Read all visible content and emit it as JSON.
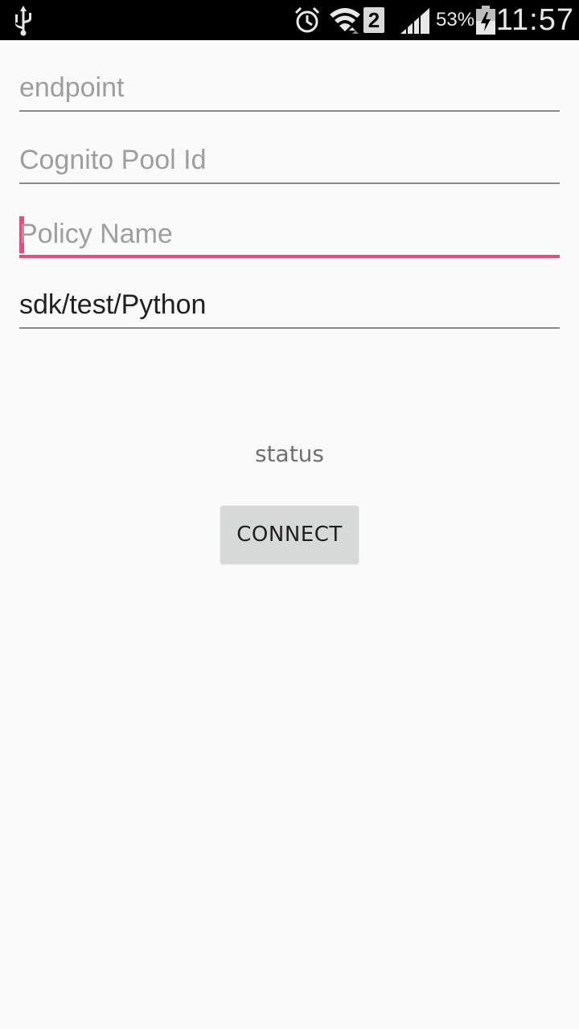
{
  "status_bar": {
    "usb_icon": "usb-icon",
    "alarm_icon": "alarm-icon",
    "wifi_icon": "wifi-icon",
    "sim_badge": "2",
    "signal_icon": "signal-icon",
    "battery_percent": "53%",
    "battery_icon": "battery-charging-icon",
    "time": "11:57"
  },
  "form": {
    "endpoint": {
      "placeholder": "endpoint",
      "value": ""
    },
    "cognito_pool_id": {
      "placeholder": "Cognito Pool Id",
      "value": ""
    },
    "policy_name": {
      "placeholder": "Policy Name",
      "value": "",
      "focused": true
    },
    "topic": {
      "placeholder": "",
      "value": "sdk/test/Python"
    }
  },
  "status_label": "status",
  "connect_button_label": "CONNECT",
  "colors": {
    "accent": "#e84a83",
    "background": "#fafafa",
    "button": "#d7d8d8"
  }
}
